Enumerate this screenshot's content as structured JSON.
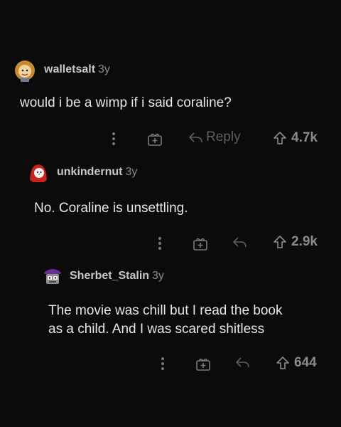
{
  "comments": [
    {
      "username": "walletsalt",
      "age": "3y",
      "text": "would i be a wimp if i said coraline?",
      "reply_label": "Reply",
      "score": "4.7k",
      "icons": {
        "more": "more-vertical-icon",
        "award": "gift-icon",
        "reply": "reply-arrow-icon",
        "upvote": "upvote-arrow-icon"
      },
      "avatar": "avatar-cartoon-lion"
    },
    {
      "username": "unkindernut",
      "age": "3y",
      "text": "No. Coraline is unsettling.",
      "score": "2.9k",
      "icons": {
        "more": "more-vertical-icon",
        "award": "gift-icon",
        "reply": "reply-arrow-icon",
        "upvote": "upvote-arrow-icon"
      },
      "avatar": "avatar-red-hood"
    },
    {
      "username": "Sherbet_Stalin",
      "age": "3y",
      "text_line1": "The movie was chill but I read the book",
      "text_line2": "as a child. And I was scared shitless",
      "score": "644",
      "icons": {
        "more": "more-vertical-icon",
        "award": "gift-icon",
        "reply": "reply-arrow-icon",
        "upvote": "upvote-arrow-icon"
      },
      "avatar": "avatar-robot-cap"
    }
  ],
  "colors": {
    "background": "#0b0b0b",
    "text": "#e6e6e6",
    "muted": "#6f6f6f"
  }
}
